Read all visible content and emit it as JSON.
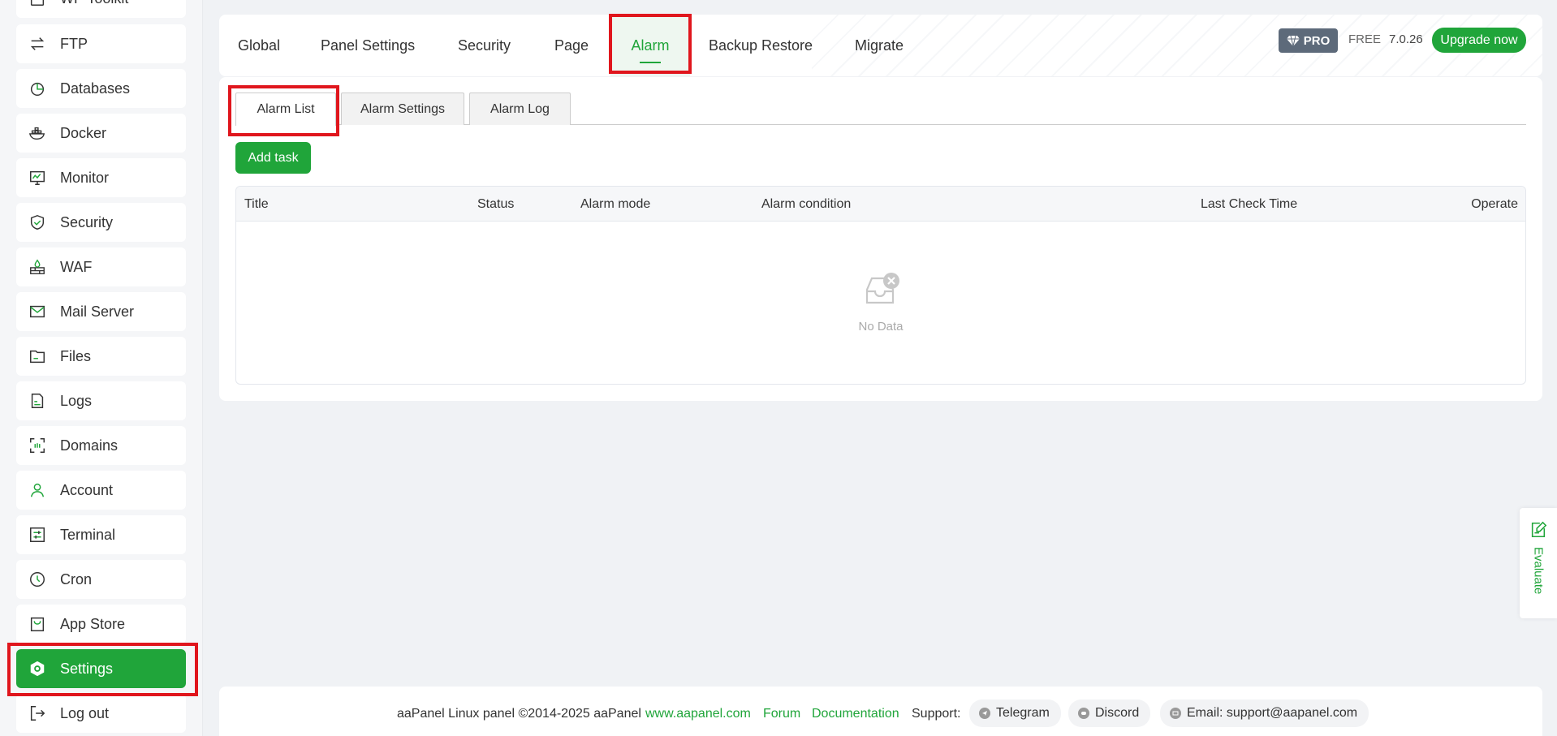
{
  "sidebar": {
    "items": [
      {
        "label": "WP Toolkit",
        "icon": "wp-toolkit-icon"
      },
      {
        "label": "FTP",
        "icon": "ftp-icon"
      },
      {
        "label": "Databases",
        "icon": "database-icon"
      },
      {
        "label": "Docker",
        "icon": "docker-icon"
      },
      {
        "label": "Monitor",
        "icon": "monitor-icon"
      },
      {
        "label": "Security",
        "icon": "shield-icon"
      },
      {
        "label": "WAF",
        "icon": "firewall-icon"
      },
      {
        "label": "Mail Server",
        "icon": "mail-icon"
      },
      {
        "label": "Files",
        "icon": "folder-icon"
      },
      {
        "label": "Logs",
        "icon": "log-icon"
      },
      {
        "label": "Domains",
        "icon": "domain-icon"
      },
      {
        "label": "Account",
        "icon": "user-icon"
      },
      {
        "label": "Terminal",
        "icon": "terminal-icon"
      },
      {
        "label": "Cron",
        "icon": "clock-icon"
      },
      {
        "label": "App Store",
        "icon": "app-store-icon"
      },
      {
        "label": "Settings",
        "icon": "settings-icon"
      },
      {
        "label": "Log out",
        "icon": "logout-icon"
      }
    ],
    "active": "Settings"
  },
  "topnav": {
    "tabs": [
      "Global",
      "Panel Settings",
      "Security",
      "Page",
      "Alarm",
      "Backup Restore",
      "Migrate"
    ],
    "active": "Alarm",
    "pro_label": "PRO",
    "free_label": "FREE",
    "version": "7.0.26",
    "upgrade_label": "Upgrade now"
  },
  "subtabs": {
    "items": [
      "Alarm List",
      "Alarm Settings",
      "Alarm Log"
    ],
    "active": "Alarm List"
  },
  "add_task_label": "Add task",
  "table": {
    "columns": [
      "Title",
      "Status",
      "Alarm mode",
      "Alarm condition",
      "Last Check Time",
      "Operate"
    ],
    "empty_text": "No Data"
  },
  "evaluate_label": "Evaluate",
  "footer": {
    "copyright": "aaPanel Linux panel ©2014-2025 aaPanel",
    "website": "www.aapanel.com",
    "forum": "Forum",
    "documentation": "Documentation",
    "support_label": "Support:",
    "telegram": "Telegram",
    "discord": "Discord",
    "email": "Email: support@aapanel.com"
  },
  "colors": {
    "brand_green": "#20a53a",
    "highlight_red": "#e0161d",
    "pro_badge": "#5d6a7a"
  }
}
